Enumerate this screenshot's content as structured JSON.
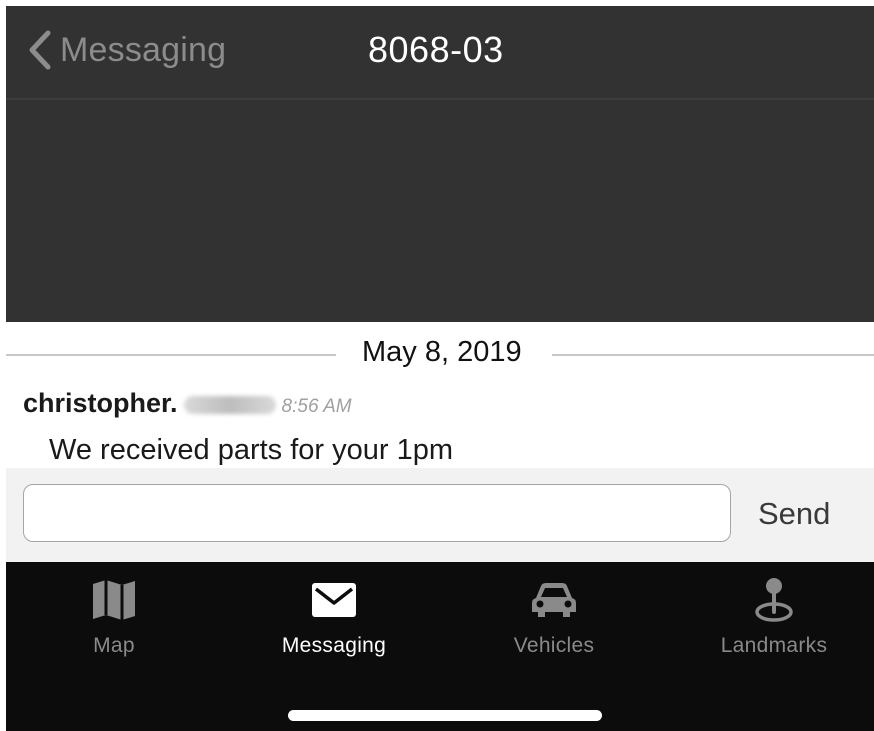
{
  "nav": {
    "back_label": "Messaging",
    "title": "8068-03"
  },
  "conversation": {
    "date": "May 8, 2019",
    "message": {
      "sender": "christopher.",
      "time": "8:56 AM",
      "text": "We received parts for your 1pm"
    }
  },
  "compose": {
    "input_value": "",
    "send_label": "Send"
  },
  "tabs": [
    {
      "label": "Map",
      "icon": "map-icon",
      "active": false
    },
    {
      "label": "Messaging",
      "icon": "envelope-icon",
      "active": true
    },
    {
      "label": "Vehicles",
      "icon": "car-icon",
      "active": false
    },
    {
      "label": "Landmarks",
      "icon": "landmark-pin-icon",
      "active": false
    }
  ],
  "colors": {
    "header_bg": "#323232",
    "tabbar_bg": "#0c0c0c",
    "tab_inactive": "#8a8a8a",
    "tab_active": "#ffffff"
  }
}
